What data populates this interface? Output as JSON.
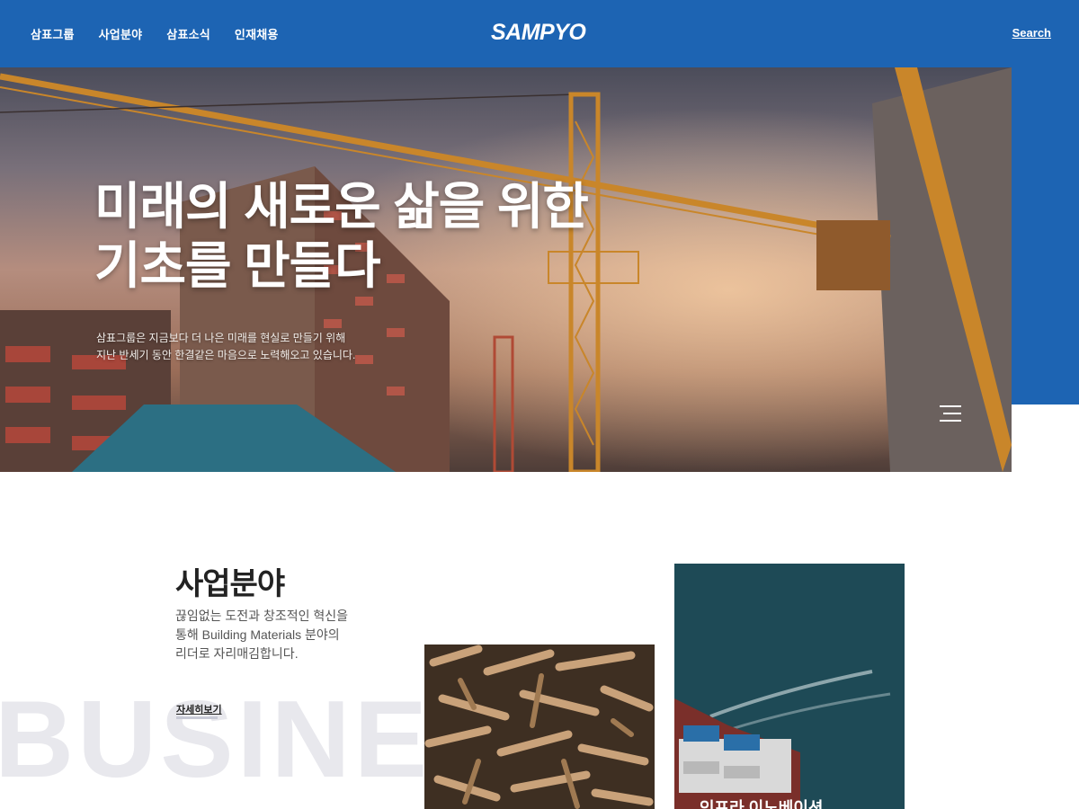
{
  "header": {
    "nav": [
      "삼표그룹",
      "사업분야",
      "삼표소식",
      "인재채용"
    ],
    "logo": "SAMPYO",
    "search": "Search"
  },
  "hero": {
    "title_line1": "미래의 새로운 삶을 위한",
    "title_line2": "기초를 만들다",
    "desc_line1": "삼표그룹은 지금보다 더 나은 미래를 현실로 만들기 위해",
    "desc_line2": "지난 반세기 동안 한결같은 마음으로 노력해오고 있습니다."
  },
  "business": {
    "title": "사업분야",
    "desc_line1": "끊임없는 도전과 창조적인 혁신을",
    "desc_line2": "통해 Building Materials 분야의",
    "desc_line3": "리더로 자리매김합니다.",
    "more": "자세히보기",
    "bg_word": "BUSINESS",
    "sea_caption": "인프라 이노베이션"
  },
  "colors": {
    "brand_blue": "#1d64b3",
    "bg_word": "#e8e8ed"
  }
}
